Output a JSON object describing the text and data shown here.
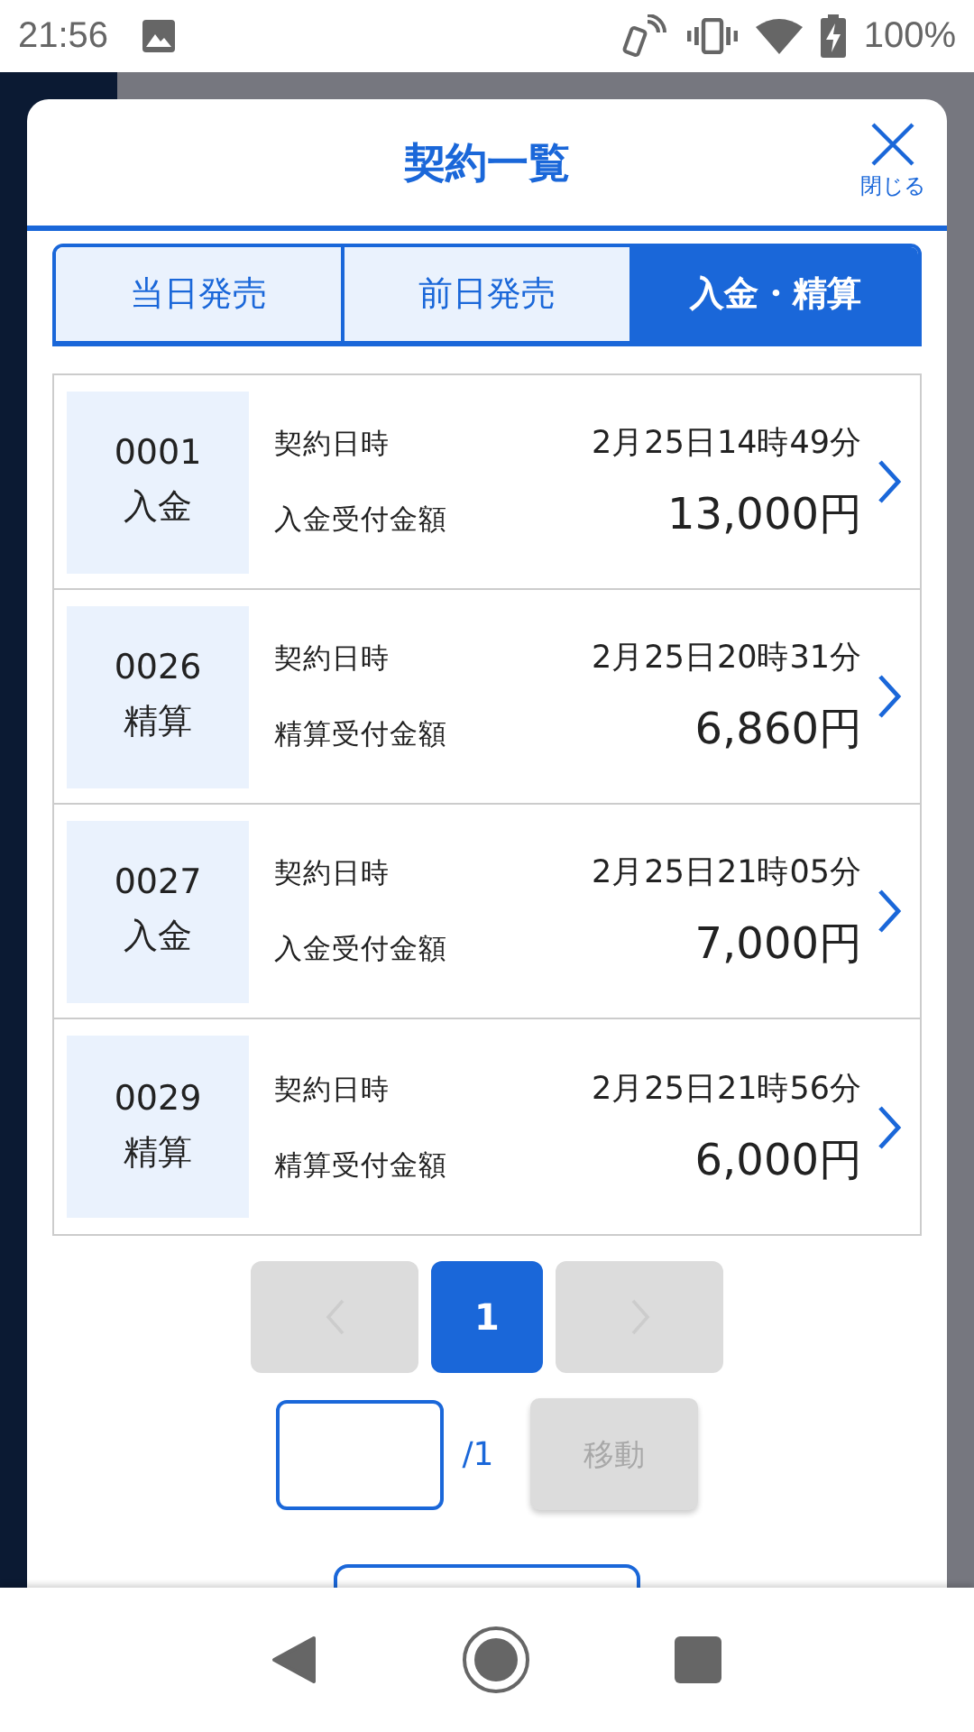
{
  "status_bar": {
    "time": "21:56",
    "battery": "100%"
  },
  "dialog": {
    "title": "契約一覧",
    "close_label": "閉じる"
  },
  "tabs": [
    {
      "label": "当日発売",
      "selected": false
    },
    {
      "label": "前日発売",
      "selected": false
    },
    {
      "label": "入金・精算",
      "selected": true
    }
  ],
  "contracts": [
    {
      "number": "0001",
      "type": "入金",
      "date_label": "契約日時",
      "date": "2月25日14時49分",
      "amount_label": "入金受付金額",
      "amount": "13,000円"
    },
    {
      "number": "0026",
      "type": "精算",
      "date_label": "契約日時",
      "date": "2月25日20時31分",
      "amount_label": "精算受付金額",
      "amount": "6,860円"
    },
    {
      "number": "0027",
      "type": "入金",
      "date_label": "契約日時",
      "date": "2月25日21時05分",
      "amount_label": "入金受付金額",
      "amount": "7,000円"
    },
    {
      "number": "0029",
      "type": "精算",
      "date_label": "契約日時",
      "date": "2月25日21時56分",
      "amount_label": "精算受付金額",
      "amount": "6,000円"
    }
  ],
  "pagination": {
    "prev_disabled": true,
    "pages": [
      {
        "label": "1",
        "selected": true
      }
    ],
    "next_disabled": true
  },
  "page_jump": {
    "total": "/1",
    "button": "移動",
    "disabled": true
  }
}
